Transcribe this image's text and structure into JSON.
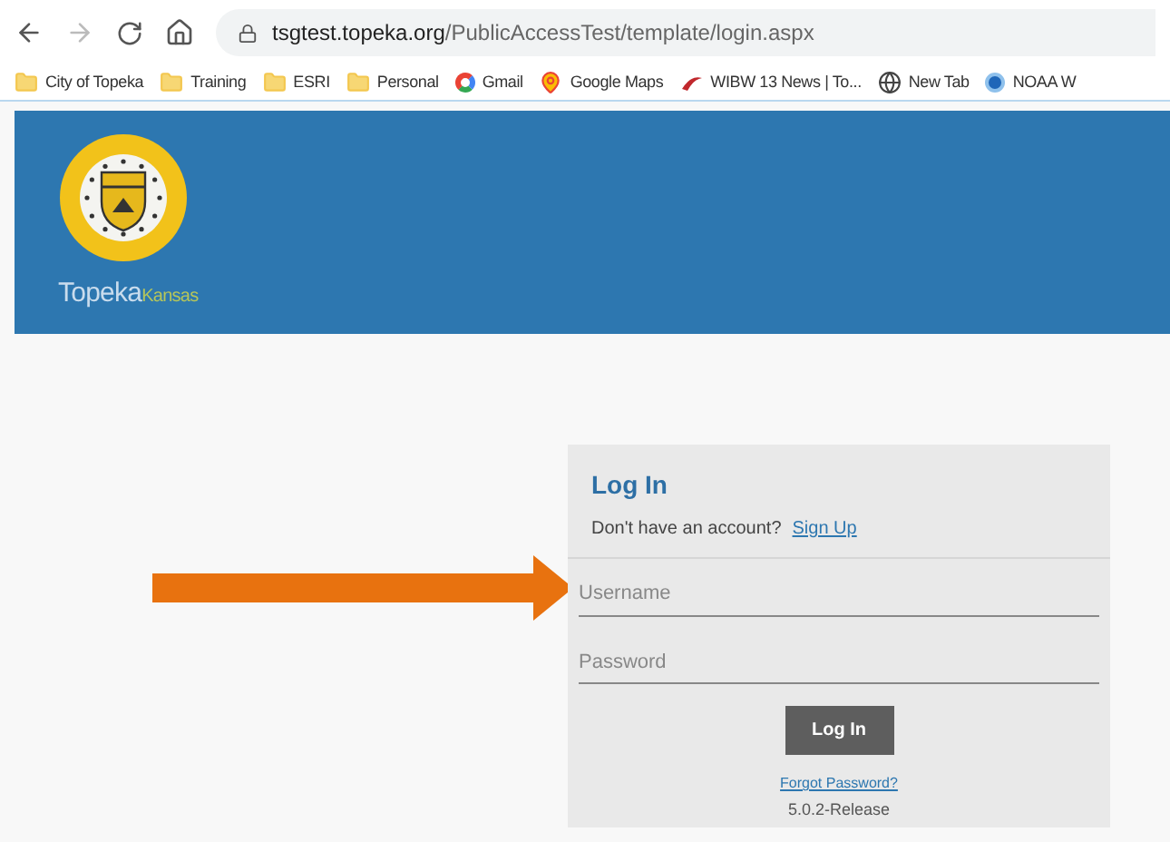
{
  "browser": {
    "url_host": "tsgtest.topeka.org",
    "url_path": "/PublicAccessTest/template/login.aspx",
    "bookmarks": [
      {
        "kind": "folder",
        "label": "City of Topeka"
      },
      {
        "kind": "folder",
        "label": "Training"
      },
      {
        "kind": "folder",
        "label": "ESRI"
      },
      {
        "kind": "folder",
        "label": "Personal"
      },
      {
        "kind": "gmail",
        "label": "Gmail"
      },
      {
        "kind": "maps",
        "label": "Google Maps"
      },
      {
        "kind": "news",
        "label": "WIBW 13 News | To..."
      },
      {
        "kind": "globe",
        "label": "New Tab"
      },
      {
        "kind": "noaa",
        "label": "NOAA W"
      }
    ]
  },
  "header": {
    "brand": "Topeka",
    "brand_suffix": "Kansas"
  },
  "login": {
    "title": "Log In",
    "prompt": "Don't have an account?",
    "signup_link": "Sign Up",
    "fields": [
      {
        "placeholder": "Username"
      },
      {
        "placeholder": "Password"
      }
    ],
    "submit": "Log In",
    "forgot_link": "Forgot Password?",
    "version": "5.0.2-Release"
  }
}
